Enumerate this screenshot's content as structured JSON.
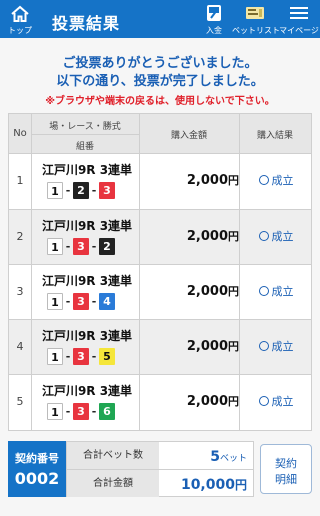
{
  "header": {
    "home_label": "トップ",
    "title": "投票結果",
    "deposit_label": "入金",
    "betlist_label": "ベットリスト",
    "mypage_label": "マイページ",
    "bg_color": "#1573c7"
  },
  "messages": {
    "line1": "ご投票ありがとうございました。",
    "line2": "以下の通り、投票が完了しました。",
    "warning": "※ブラウザや端末の戻るは、使用しないで下さい。"
  },
  "table": {
    "headers": {
      "no": "No",
      "place_race_type": "場・レース・勝式",
      "combination": "組番",
      "amount": "購入金額",
      "result": "購入結果"
    },
    "rows": [
      {
        "no": "1",
        "race": "江戸川9R 3連単",
        "c1": "1",
        "c2": "2",
        "c3": "3",
        "amount": "2,000",
        "unit": "円",
        "result": "成立"
      },
      {
        "no": "2",
        "race": "江戸川9R 3連単",
        "c1": "1",
        "c2": "3",
        "c3": "2",
        "amount": "2,000",
        "unit": "円",
        "result": "成立"
      },
      {
        "no": "3",
        "race": "江戸川9R 3連単",
        "c1": "1",
        "c2": "3",
        "c3": "4",
        "amount": "2,000",
        "unit": "円",
        "result": "成立"
      },
      {
        "no": "4",
        "race": "江戸川9R 3連単",
        "c1": "1",
        "c2": "3",
        "c3": "5",
        "amount": "2,000",
        "unit": "円",
        "result": "成立"
      },
      {
        "no": "5",
        "race": "江戸川9R 3連単",
        "c1": "1",
        "c2": "3",
        "c3": "6",
        "amount": "2,000",
        "unit": "円",
        "result": "成立"
      }
    ]
  },
  "boat_colors": {
    "1": {
      "bg": "#ffffff",
      "fg": "#111111"
    },
    "2": {
      "bg": "#222222",
      "fg": "#ffffff"
    },
    "3": {
      "bg": "#e8343f",
      "fg": "#ffffff"
    },
    "4": {
      "bg": "#2a7bd8",
      "fg": "#ffffff"
    },
    "5": {
      "bg": "#f5e63a",
      "fg": "#111111"
    },
    "6": {
      "bg": "#1fa653",
      "fg": "#ffffff"
    }
  },
  "footer": {
    "contract_label": "契約番号",
    "contract_no": "0002",
    "total_bets_label": "合計ベット数",
    "total_bets_value": "5",
    "total_bets_unit": "ベット",
    "total_amount_label": "合計金額",
    "total_amount_value": "10,000",
    "total_amount_unit": "円",
    "detail_line1": "契約",
    "detail_line2": "明細"
  }
}
